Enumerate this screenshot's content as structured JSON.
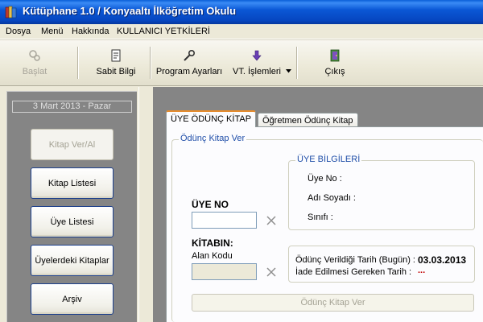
{
  "window": {
    "title": "Kütüphane 1.0 / Konyaaltı İlköğretim Okulu"
  },
  "menu": {
    "items": [
      "Dosya",
      "Menü",
      "Hakkında",
      "KULLANICI YETKİLERİ"
    ]
  },
  "toolbar": {
    "baslat": "Başlat",
    "sabit_bilgi": "Sabit Bilgi",
    "program_ayarlari": "Program Ayarları",
    "vt_islemleri": "VT. İşlemleri",
    "cikis": "Çıkış"
  },
  "sidebar": {
    "date": "3 Mart 2013 - Pazar",
    "buttons": [
      "Kitap Ver/Al",
      "Kitap Listesi",
      "Üye Listesi",
      "Üyelerdeki Kitaplar",
      "Arşiv"
    ]
  },
  "tabs": [
    "ÜYE ÖDÜNÇ KİTAP",
    "Öğretmen Ödünç Kitap"
  ],
  "form": {
    "group_title": "Ödünç Kitap Ver",
    "uye_no_label": "ÜYE NO",
    "uye_no_value": "",
    "kitabin_label": "KİTABIN:",
    "alan_kodu_label": "Alan Kodu",
    "alan_kodu_value": "",
    "uye_bilgileri": {
      "title": "ÜYE BİLGİLERİ",
      "uye_no": "Üye No :",
      "adi_soyadi": "Adı Soyadı :",
      "sinifi": "Sınıfı :"
    },
    "dates": {
      "verildigi_label": "Ödünç Verildiği Tarih (Bugün) :",
      "verildigi_value": "03.03.2013",
      "iade_label": "İade Edilmesi Gereken Tarih :",
      "iade_value": "..."
    },
    "submit_label": "Ödünç Kitap Ver"
  },
  "colors": {
    "accent": "#0a5fd8",
    "tab_highlight": "#e68b2c",
    "workspace": "#858585",
    "date_value": "#000000",
    "iade_value": "#c00000"
  }
}
